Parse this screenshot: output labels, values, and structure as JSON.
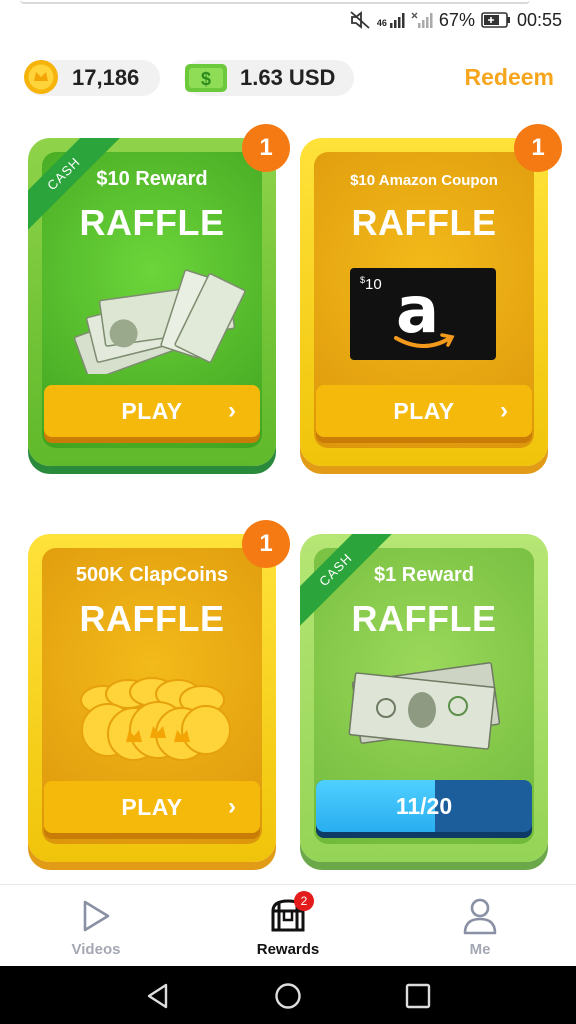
{
  "status_bar": {
    "signal_left": "46",
    "battery_percent": "67%",
    "time": "00:55"
  },
  "header": {
    "coins_value": "17,186",
    "cash_value": "1.63 USD",
    "redeem_label": "Redeem"
  },
  "cards": [
    {
      "ribbon": "CASH",
      "title": "$10 Reward",
      "subtitle": "RAFFLE",
      "art": "money-stack",
      "button_label": "PLAY",
      "badge": "1"
    },
    {
      "title": "$10 Amazon Coupon",
      "subtitle": "RAFFLE",
      "art": "amazon-giftcard",
      "giftcard_amount": "10",
      "giftcard_currency": "$",
      "button_label": "PLAY",
      "badge": "1"
    },
    {
      "title": "500K ClapCoins",
      "subtitle": "RAFFLE",
      "art": "coin-stack",
      "button_label": "PLAY",
      "badge": "1"
    },
    {
      "ribbon": "CASH",
      "title": "$1 Reward",
      "subtitle": "RAFFLE",
      "art": "dollar-bills",
      "progress_label": "11/20",
      "progress_fraction": 0.55
    }
  ],
  "bottom_nav": {
    "items": [
      {
        "label": "Videos",
        "icon": "play-outline-icon"
      },
      {
        "label": "Rewards",
        "icon": "treasure-chest-icon",
        "badge": "2"
      },
      {
        "label": "Me",
        "icon": "user-outline-icon"
      }
    ]
  },
  "colors": {
    "accent": "#f7a51c",
    "green_card": "#5fb92a",
    "gold_card": "#f0c40a",
    "badge": "#f57a14"
  }
}
